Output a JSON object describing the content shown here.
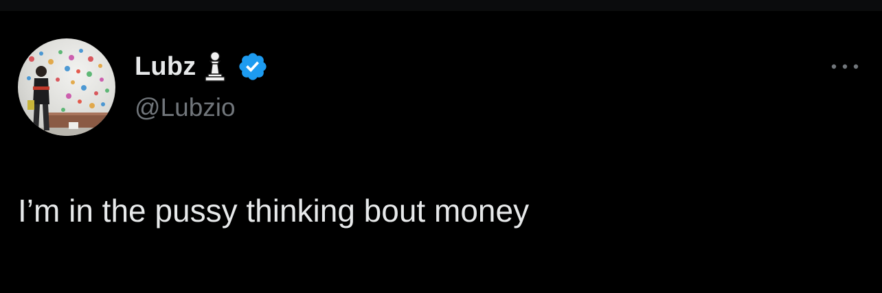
{
  "tweet": {
    "author": {
      "display_name": "Lubz",
      "handle": "@Lubzio",
      "badge_icon": "chess-pawn-icon",
      "verified_icon": "verified-badge-icon",
      "avatar": "user-avatar-photo"
    },
    "text": "I’m in the pussy thinking bout money",
    "more_icon": "more-options-icon"
  },
  "colors": {
    "background": "#000000",
    "primary_text": "#e7e9ea",
    "secondary_text": "#71767b",
    "verified_blue": "#1d9bf0"
  }
}
